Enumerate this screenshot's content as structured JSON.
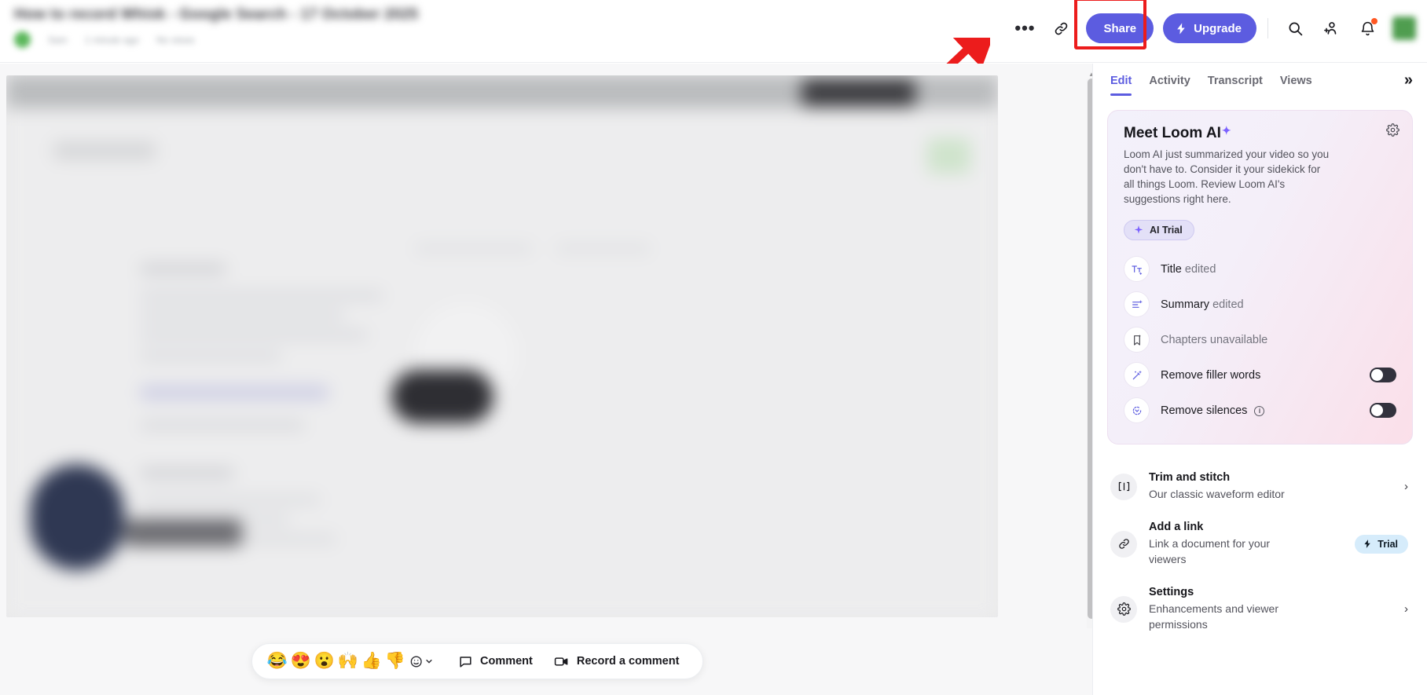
{
  "topbar": {
    "video_title": "How to record Whisk - Google Search - 17 October 2025",
    "meta": [
      "Sam",
      "1 minute ago",
      "No views"
    ],
    "more_label": "•••",
    "link_icon": "link-icon",
    "share_label": "Share",
    "upgrade_label": "Upgrade",
    "search_icon": "search-icon",
    "invite_icon": "invite-people-icon",
    "bell_icon": "notifications-icon",
    "accent": "#5c5ce0",
    "highlight_color": "#ec1c1c"
  },
  "reaction_bar": {
    "emojis": [
      "😂",
      "😍",
      "😮",
      "🙌",
      "👍",
      "👎"
    ],
    "more_label": "more-reactions",
    "comment_label": "Comment",
    "record_label": "Record a comment"
  },
  "panel": {
    "tabs": [
      {
        "label": "Edit",
        "active": true
      },
      {
        "label": "Activity",
        "active": false
      },
      {
        "label": "Transcript",
        "active": false
      },
      {
        "label": "Views",
        "active": false
      }
    ],
    "collapse_label": "»",
    "ai_card": {
      "title": "Meet Loom AI",
      "sparkle": "✦",
      "description": "Loom AI just summarized your video so you don't have to. Consider it your sidekick for all things Loom. Review Loom AI's suggestions right here.",
      "trial_label": "AI Trial",
      "gear_icon": "gear-icon",
      "rows": [
        {
          "icon": "title-ai-icon",
          "label": "Title",
          "status": "edited",
          "type": "status"
        },
        {
          "icon": "summary-ai-icon",
          "label": "Summary",
          "status": "edited",
          "type": "status"
        },
        {
          "icon": "chapters-ai-icon",
          "label": "Chapters",
          "status": "unavailable",
          "type": "unavailable"
        },
        {
          "icon": "magic-wand-icon",
          "label": "Remove filler words",
          "type": "toggle",
          "toggle_on": false
        },
        {
          "icon": "remove-silences-icon",
          "label": "Remove silences",
          "type": "toggle",
          "toggle_on": false,
          "has_info": true
        }
      ]
    },
    "list": [
      {
        "icon": "trim-stitch-icon",
        "title": "Trim and stitch",
        "subtitle": "Our classic waveform editor",
        "chevron": "›",
        "badge": null
      },
      {
        "icon": "link-icon",
        "title": "Add a link",
        "subtitle": "Link a document for your viewers",
        "chevron": null,
        "badge": "Trial"
      },
      {
        "icon": "gear-icon",
        "title": "Settings",
        "subtitle": "Enhancements and viewer permissions",
        "chevron": "›",
        "badge": null
      }
    ]
  }
}
